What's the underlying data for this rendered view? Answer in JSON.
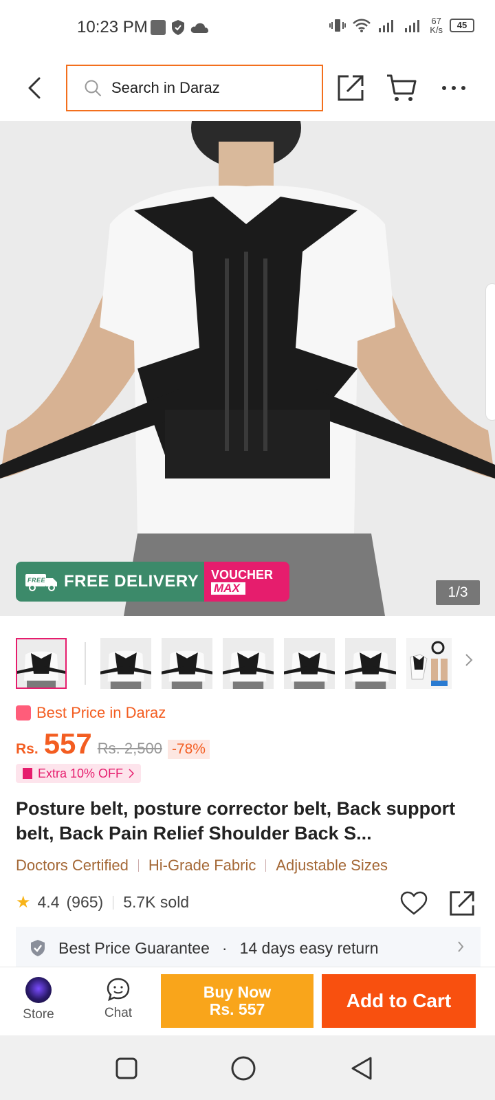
{
  "status_bar": {
    "time": "10:23 PM",
    "net_speed_value": "67",
    "net_speed_unit": "K/s",
    "battery": "45"
  },
  "top_bar": {
    "search_placeholder": "Search in Daraz"
  },
  "hero": {
    "counter": "1/3",
    "free_delivery_tag": "FREE",
    "free_delivery": "FREE DELIVERY",
    "voucher_line1": "VOUCHER",
    "voucher_line2": "MAX"
  },
  "thumbnails": {
    "count": 8,
    "active_index": 0
  },
  "product": {
    "best_price_label": "Best Price in Daraz",
    "currency": "Rs.",
    "price": "557",
    "old_price": "Rs. 2,500",
    "discount": "-78%",
    "extra_off": "Extra 10% OFF",
    "title": "Posture belt, posture corrector belt, Back support belt, Back Pain Relief Shoulder Back S...",
    "features": [
      "Doctors Certified",
      "Hi-Grade Fabric",
      "Adjustable Sizes"
    ],
    "rating": "4.4",
    "reviews": "(965)",
    "sold": "5.7K sold"
  },
  "guarantee": {
    "item1": "Best Price Guarantee",
    "separator": "·",
    "item2": "14 days easy return"
  },
  "action_bar": {
    "store_label": "Store",
    "chat_label": "Chat",
    "buy_now_label": "Buy Now",
    "buy_now_price": "Rs. 557",
    "add_to_cart_label": "Add to Cart"
  },
  "colors": {
    "accent_orange": "#f35d21",
    "buy_now": "#f9a51b",
    "add_to_cart": "#f8500f",
    "pink": "#e61d6d",
    "feature_brown": "#a46836",
    "free_delivery_green": "#3c8a6a"
  }
}
